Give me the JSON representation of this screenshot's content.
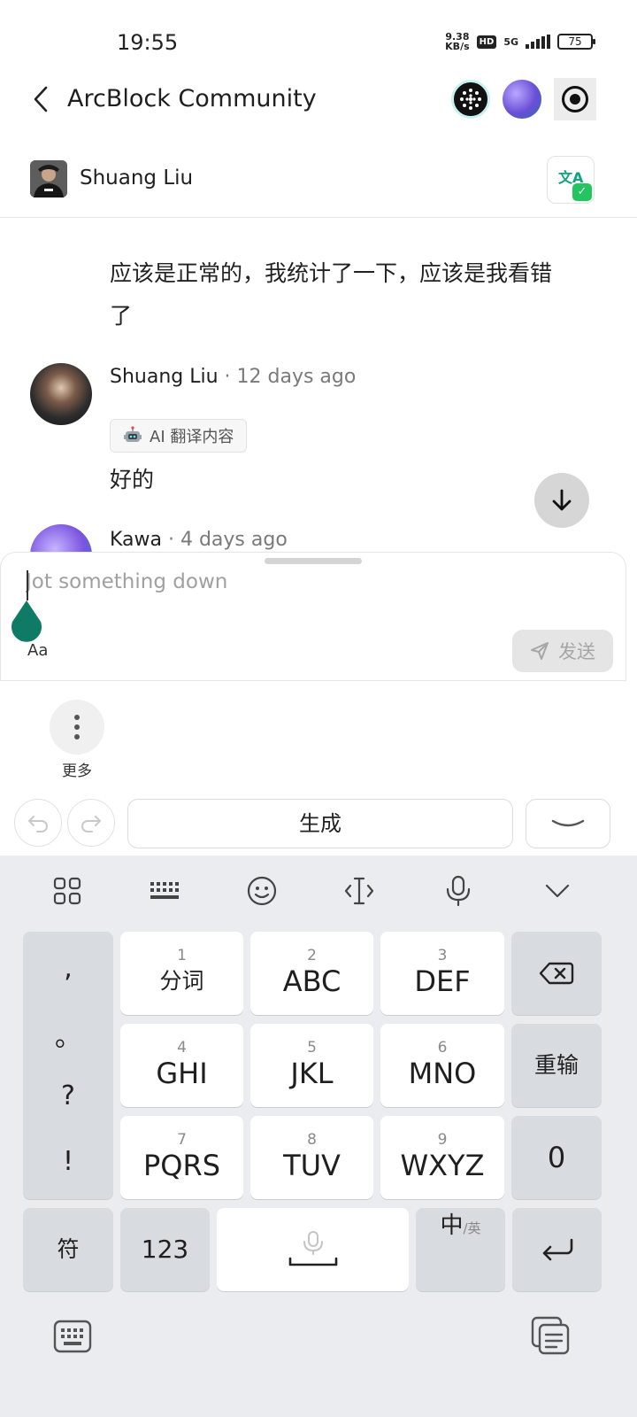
{
  "status": {
    "time": "19:55",
    "net_speed_value": "9.38",
    "net_speed_unit": "KB/s",
    "hd": "HD",
    "network": "5G",
    "battery": "75"
  },
  "header": {
    "title": "ArcBlock Community"
  },
  "author_bar": {
    "name": "Shuang Liu"
  },
  "messages": [
    {
      "text": "应该是正常的，我统计了一下，应该是我看错了"
    },
    {
      "author": "Shuang Liu",
      "time": " · 12 days ago",
      "badge": "AI 翻译内容",
      "text": "好的"
    },
    {
      "author": "Kawa",
      "time": " · 4 days ago"
    }
  ],
  "composer": {
    "placeholder": "Jot something down",
    "format_label": "Aa",
    "send_label": "发送"
  },
  "more": {
    "label": "更多"
  },
  "ime_toolbar": {
    "generate_label": "生成"
  },
  "keyboard": {
    "punctuation": [
      ",",
      "。",
      "?",
      "!"
    ],
    "rows": [
      [
        {
          "num": "1",
          "label": "分词"
        },
        {
          "num": "2",
          "label": "ABC"
        },
        {
          "num": "3",
          "label": "DEF"
        }
      ],
      [
        {
          "num": "4",
          "label": "GHI"
        },
        {
          "num": "5",
          "label": "JKL"
        },
        {
          "num": "6",
          "label": "MNO"
        }
      ],
      [
        {
          "num": "7",
          "label": "PQRS"
        },
        {
          "num": "8",
          "label": "TUV"
        },
        {
          "num": "9",
          "label": "WXYZ"
        }
      ]
    ],
    "reinput_label": "重输",
    "zero_label": "0",
    "symbols_label": "符",
    "numbers_label": "123",
    "lang_main": "中",
    "lang_alt": "/英"
  },
  "colors": {
    "accent_teal": "#0f7a66",
    "keyboard_bg": "#eaecef"
  }
}
